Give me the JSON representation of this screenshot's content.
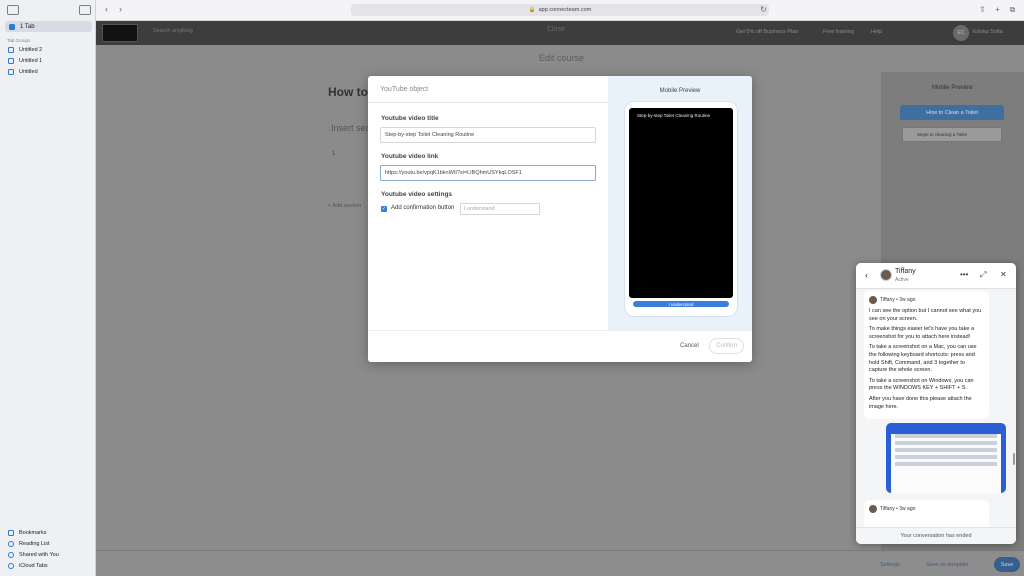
{
  "sidebar": {
    "tab_label": "1 Tab",
    "section_label": "Tab Groups",
    "groups": [
      "Untitled 2",
      "Untitled 1",
      "Untitled"
    ],
    "bottom_items": [
      "Bookmarks",
      "Reading List",
      "Shared with You",
      "iCloud Tabs"
    ]
  },
  "browser": {
    "url": "app.connecteam.com",
    "back_icon": "chevron-left-icon",
    "forward_icon": "chevron-right-icon",
    "reload_icon": "reload-icon"
  },
  "app_header": {
    "search_placeholder": "Search anything",
    "refer_text": "Get 5% off Business Plan",
    "training_text": "Free training",
    "help_text": "Help",
    "user_initials": "EC",
    "user_name": "Edoka Sofia"
  },
  "page": {
    "close_label": "Close",
    "edit_title": "Edit course",
    "course_heading": "How to Clean a Toilet",
    "insert_section": "Insert section",
    "section_number": "1",
    "add_section": "+ Add section",
    "mobile_preview_label": "Mobile Preview",
    "mobile_preview_title": "How to Clean a Toilet",
    "mobile_preview_item": "Steps to cleaning a Toilet",
    "settings_label": "Settings",
    "save_template_label": "Save as template",
    "save_label": "Save"
  },
  "modal": {
    "title": "YouTube object",
    "title_label": "Youtube video title",
    "title_value": "Step-by-step Toilet Cleaning Routine",
    "link_label": "Youtube video link",
    "link_value": "https://youtu.be/vpqK1bknWtI?si=LIBQhmUSYkqLOSF1",
    "settings_label": "Youtube video settings",
    "confirmation_label": "Add confirmation button",
    "confirmation_placeholder": "I understand",
    "preview_label": "Mobile Preview",
    "preview_video_title": "Step-by-step Toilet Cleaning Routine",
    "preview_button": "I understand",
    "cancel": "Cancel",
    "confirm": "Confirm"
  },
  "chat": {
    "agent_name": "Tiffany",
    "agent_status": "Active",
    "msg1_head": "Tiffany • 3w ago",
    "msg1_p1": "I can see the option but I cannot see what you see on your screen.",
    "msg1_p2": "To make things easier let's have you take a screenshot for you to attach here instead!",
    "msg1_p3": "To take a screenshot on a Mac, you can use the following keyboard shortcuts: press and hold Shift, Command, and 3 together to capture the whole screen.",
    "msg1_p4": "To take a screenshot on Windows, you can press the WINDOWS KEY + SHIFT + S.",
    "msg1_p5": "After you have done this please attach the image here.",
    "msg2_head": "Tiffany • 3w ago",
    "footer": "Your conversation has ended"
  },
  "colors": {
    "accent": "#3b7dd8",
    "preview_bg": "#e9f1fb",
    "screenshot_border": "#2a5fd6"
  }
}
